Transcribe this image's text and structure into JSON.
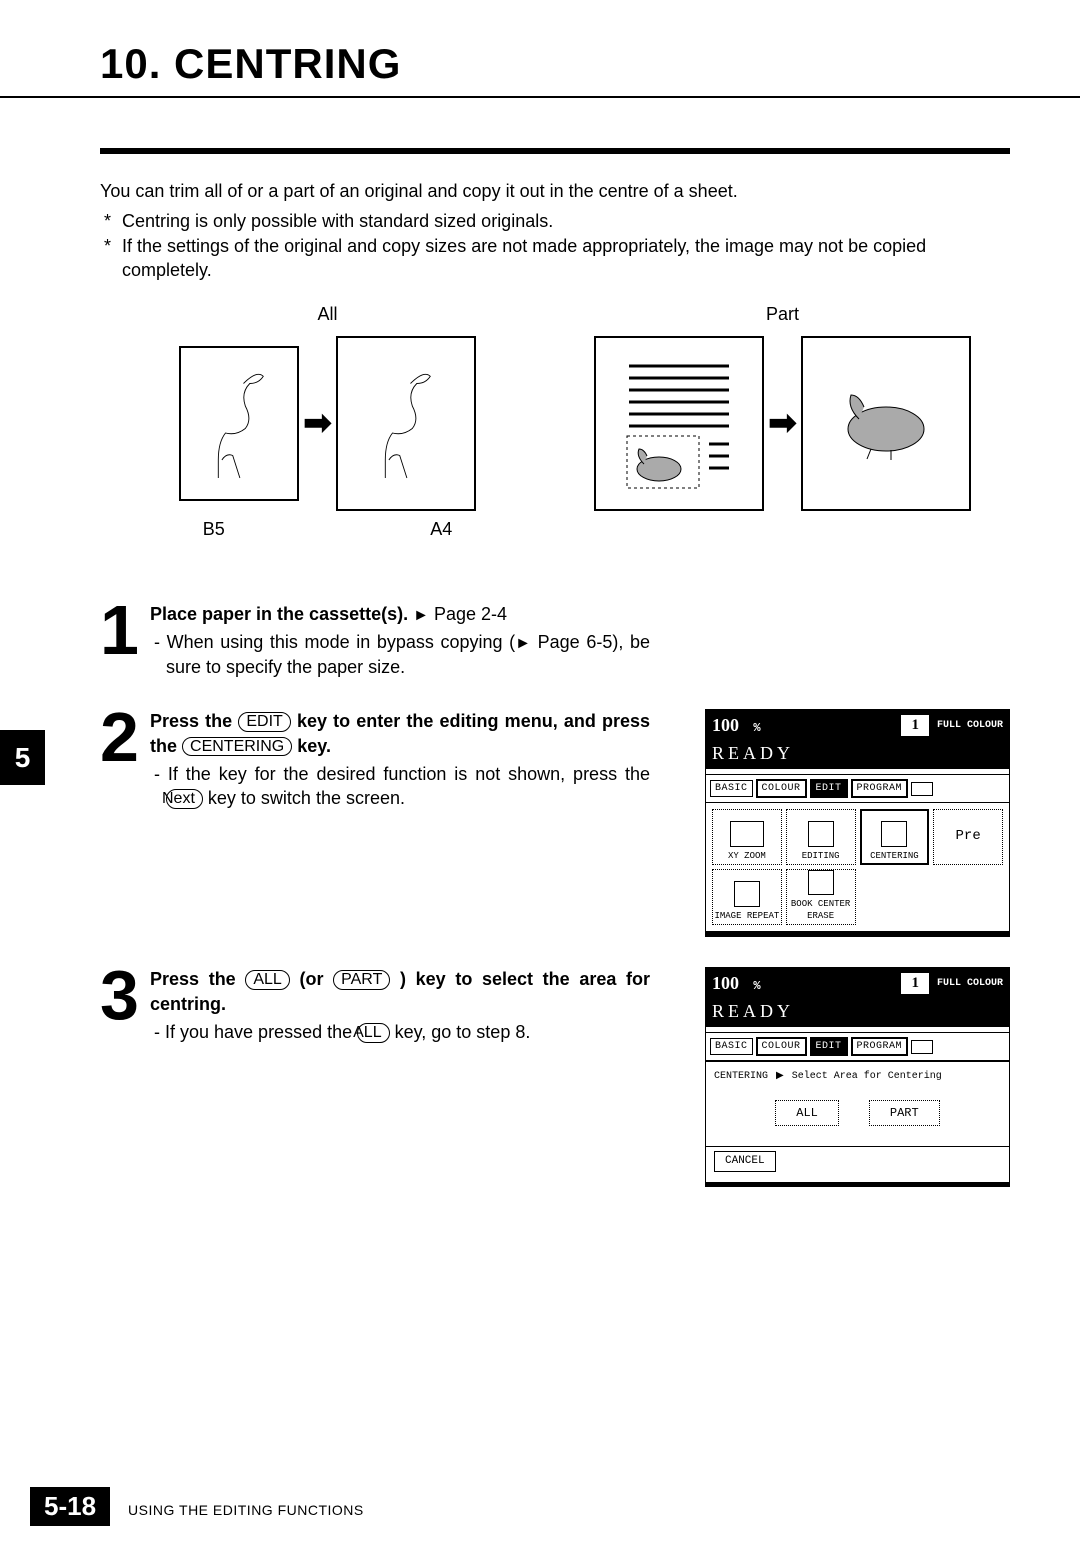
{
  "title": "10. CENTRING",
  "intro": "You can trim all of or a part of an original and copy it out in the centre of a sheet.",
  "bullets": [
    "Centring is only possible with standard sized originals.",
    "If the settings of the original and copy sizes are not made appropriately, the image may not be copied completely."
  ],
  "diagram": {
    "all_label": "All",
    "part_label": "Part",
    "b5": "B5",
    "a4": "A4"
  },
  "chapter_tab": "5",
  "steps": [
    {
      "lead": "Place paper in the cassette(s).",
      "pageref": "Page 2-4",
      "sub": "- When using this mode in bypass copying (",
      "sub_ref": "Page 6-5",
      "sub_tail": "), be sure to specify the paper size."
    },
    {
      "text_a": "Press the ",
      "key1": "EDIT",
      "text_b": " key to enter the editing menu, and press the ",
      "key2": "CENTERING",
      "text_c": " key.",
      "sub_a": "- If the key for the desired function is not shown, press the ",
      "subkey": "Next",
      "sub_b": " key to switch the screen."
    },
    {
      "text_a": "Press the ",
      "key1": "ALL",
      "text_b": " (or ",
      "key2": "PART",
      "text_c": " ) key to select the area for centring.",
      "sub_a": "- If you have pressed the ",
      "subkey": "ALL",
      "sub_b": " key, go to step 8."
    }
  ],
  "console": {
    "zoom": "100",
    "percent": "%",
    "count": "1",
    "full_colour": "FULL COLOUR",
    "ready": "READY",
    "tabs": [
      "BASIC",
      "COLOUR",
      "EDIT",
      "PROGRAM"
    ],
    "functions": [
      "XY ZOOM",
      "EDITING",
      "CENTERING",
      "Pre",
      "IMAGE REPEAT",
      "BOOK CENTER ERASE"
    ],
    "centering_label": "CENTERING",
    "select_prompt": "Select Area for Centering",
    "opt_all": "ALL",
    "opt_part": "PART",
    "cancel": "CANCEL"
  },
  "footer": {
    "page": "5-18",
    "section": "USING THE EDITING FUNCTIONS"
  }
}
